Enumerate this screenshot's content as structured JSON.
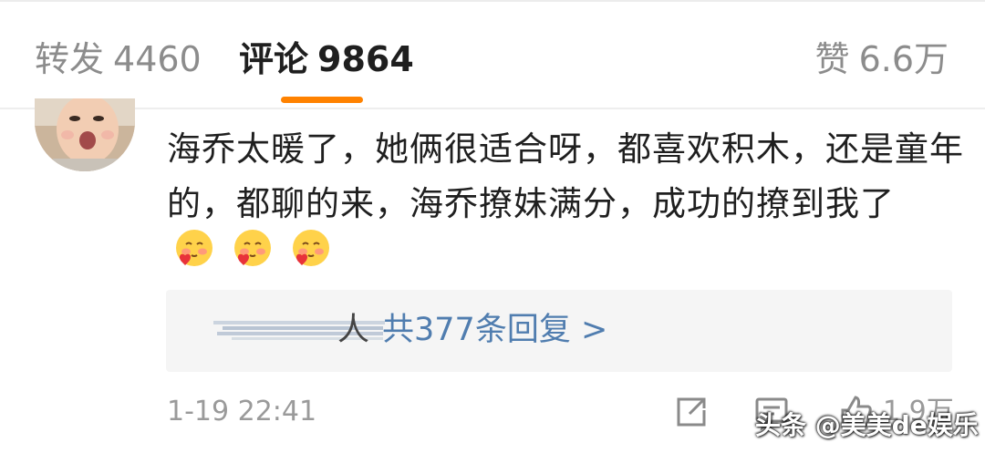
{
  "tabs": {
    "repost": {
      "label": "转发",
      "count": "4460"
    },
    "comment": {
      "label": "评论",
      "count": "9864"
    },
    "like": {
      "label": "赞",
      "count": "6.6万"
    },
    "accent_color": "#ff8200"
  },
  "comment": {
    "avatar_icon": "baby-avatar",
    "text": "海乔太暖了，她俩很适合呀，都喜欢积木，还是童年的，都聊的来，海乔撩妹满分，成功的撩到我了",
    "emojis": [
      "blush-heart-emoji",
      "blush-heart-emoji",
      "blush-heart-emoji"
    ],
    "reply_preview": {
      "person_suffix": "人",
      "link_text": "共377条回复 >",
      "link_color": "#507daf"
    },
    "timestamp": "1-19 22:41",
    "like_count": "1.9万",
    "actions": [
      "share-icon",
      "comment-icon",
      "like-icon"
    ]
  },
  "watermark": "头条 @美美de娱乐"
}
